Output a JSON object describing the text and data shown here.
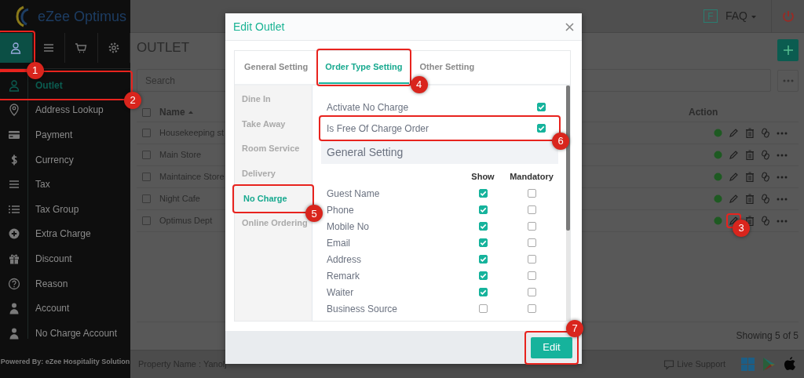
{
  "sidebar": {
    "logo": "eZee Optimus",
    "tabs": [
      {
        "selected": true,
        "callout": "1"
      },
      {
        "selected": false
      },
      {
        "selected": false
      },
      {
        "selected": false
      }
    ],
    "menu": [
      {
        "label": "Outlet",
        "selected": true,
        "callout": "2"
      },
      {
        "label": "Address Lookup",
        "selected": false
      },
      {
        "label": "Payment",
        "selected": false
      },
      {
        "label": "Currency",
        "selected": false
      },
      {
        "label": "Tax",
        "selected": false
      },
      {
        "label": "Tax Group",
        "selected": false
      },
      {
        "label": "Extra Charge",
        "selected": false
      },
      {
        "label": "Discount",
        "selected": false
      },
      {
        "label": "Reason",
        "selected": false
      },
      {
        "label": "Account",
        "selected": false
      },
      {
        "label": "No Charge Account",
        "selected": false
      }
    ],
    "footer": "Powered By: eZee Hospitality Solution"
  },
  "header": {
    "faq_badge": "F",
    "faq": "FAQ"
  },
  "page": {
    "title": "OUTLET",
    "search": {
      "placeholder": "Search"
    },
    "table": {
      "columns": [
        "Name",
        "Action"
      ],
      "select_all_checked": false,
      "rows": [
        {
          "name": "Housekeeping st",
          "checked": false
        },
        {
          "name": "Main Store",
          "checked": false
        },
        {
          "name": "Maintaince Store",
          "checked": false
        },
        {
          "name": "Night Cafe",
          "checked": false
        },
        {
          "name": "Optimus Dept",
          "checked": false,
          "edit_callout": "3"
        }
      ]
    },
    "showing": "Showing 5 of 5"
  },
  "footer": {
    "property": "Property Name : Yanolj",
    "live_support": "Live Support"
  },
  "modal": {
    "title": "Edit Outlet",
    "tabs": [
      {
        "label": "General Setting",
        "selected": false
      },
      {
        "label": "Order Type Setting",
        "selected": true,
        "callout": "4"
      },
      {
        "label": "Other Setting",
        "selected": false
      }
    ],
    "order_types": [
      {
        "label": "Dine In",
        "selected": false
      },
      {
        "label": "Take Away",
        "selected": false
      },
      {
        "label": "Room Service",
        "selected": false
      },
      {
        "label": "Delivery",
        "selected": false
      },
      {
        "label": "No Charge",
        "selected": true,
        "callout": "5"
      },
      {
        "label": "Online Ordering",
        "selected": false
      }
    ],
    "options": [
      {
        "label": "Activate No Charge",
        "checked": true
      },
      {
        "label": "Is Free Of Charge Order",
        "checked": true,
        "callout": "6"
      }
    ],
    "section": "General Setting",
    "field_columns": [
      "Show",
      "Mandatory"
    ],
    "fields": [
      {
        "label": "Guest Name",
        "show": true,
        "mandatory": false
      },
      {
        "label": "Phone",
        "show": true,
        "mandatory": false
      },
      {
        "label": "Mobile No",
        "show": true,
        "mandatory": false
      },
      {
        "label": "Email",
        "show": true,
        "mandatory": false
      },
      {
        "label": "Address",
        "show": true,
        "mandatory": false
      },
      {
        "label": "Remark",
        "show": true,
        "mandatory": false
      },
      {
        "label": "Waiter",
        "show": true,
        "mandatory": false
      },
      {
        "label": "Business Source",
        "show": false,
        "mandatory": false
      }
    ],
    "button": {
      "label": "Edit",
      "callout": "7"
    }
  }
}
